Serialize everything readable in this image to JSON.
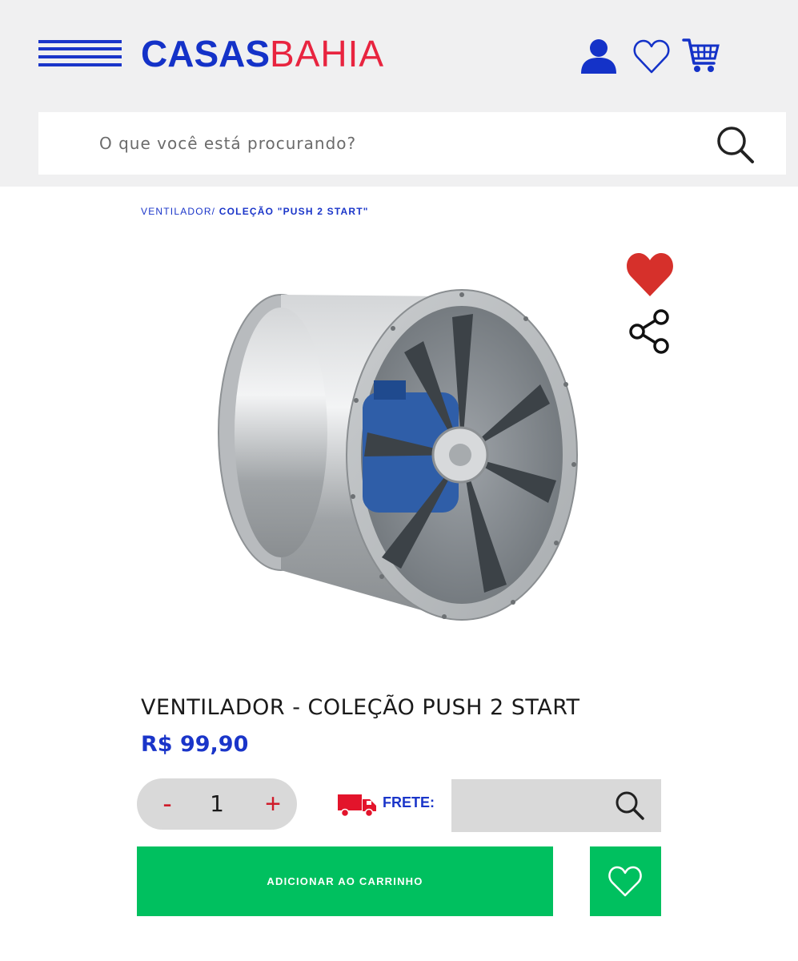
{
  "header": {
    "brand_part1": "CASAS",
    "brand_part2": "BAHIA",
    "brand_colors": {
      "casas": "#1432c8",
      "bahia": "#e8243f"
    },
    "icons": [
      "menu-icon",
      "user-icon",
      "heart-outline-icon",
      "cart-icon"
    ]
  },
  "search": {
    "placeholder": "O que você está procurando?",
    "value": "",
    "icon": "search-icon"
  },
  "breadcrumb": {
    "items": [
      "VENTILADOR/",
      "COLEÇÃO \"PUSH 2 START\""
    ]
  },
  "product": {
    "title": "VENTILADOR - COLEÇÃO PUSH 2 START",
    "price": "R$ 99,90",
    "image_alt": "ventilador axial industrial",
    "favorite_icon": "heart-filled-icon",
    "favorite_color": "#d6302b",
    "share_icon": "share-icon"
  },
  "quantity": {
    "minus": "-",
    "value": "1",
    "plus": "+"
  },
  "shipping": {
    "label": "FRETE:",
    "value": "",
    "icon": "truck-icon",
    "icon_color": "#e3142b"
  },
  "actions": {
    "add_to_cart": "ADICIONAR AO CARRINHO",
    "wishlist_icon": "heart-outline-icon",
    "accent_color": "#00c05f"
  }
}
